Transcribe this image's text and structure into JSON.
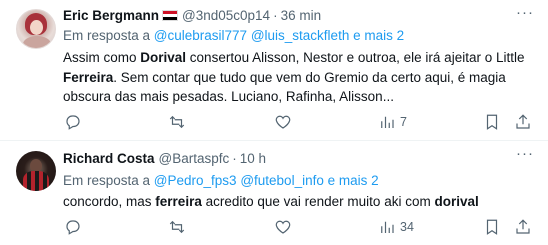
{
  "tweets": [
    {
      "author": "Eric Bergmann",
      "handle": "@3nd05c0p14",
      "separator": "·",
      "time": "36 min",
      "reply_prefix": "Em resposta a ",
      "reply_to": [
        "@culebrasil777",
        "@luis_stackfleth",
        "e mais 2"
      ],
      "text_parts": [
        {
          "t": "Assim como ",
          "b": false
        },
        {
          "t": "Dorival",
          "b": true
        },
        {
          "t": " consertou Alisson, Nestor e outroa, ele irá ajeitar o Little ",
          "b": false
        },
        {
          "t": "Ferreira",
          "b": true
        },
        {
          "t": ". Sem contar que tudo que vem do Gremio da certo aqui, é magia obscura das mais pesadas. Luciano, Rafinha, Alisson...",
          "b": false
        }
      ],
      "views": "7",
      "more_icon": "more-dots-icon"
    },
    {
      "author": "Richard Costa",
      "handle": "@Bartaspfc",
      "separator": "·",
      "time": "10 h",
      "reply_prefix": "Em resposta a ",
      "reply_to": [
        "@Pedro_fps3",
        "@futebol_info",
        "e mais 2"
      ],
      "text_parts": [
        {
          "t": "concordo, mas ",
          "b": false
        },
        {
          "t": "ferreira",
          "b": true
        },
        {
          "t": " acredito que vai render muito aki com ",
          "b": false
        },
        {
          "t": "dorival",
          "b": true
        }
      ],
      "views": "34",
      "more_icon": "more-dots-icon"
    }
  ],
  "colors": {
    "link": "#1d9bf0",
    "muted": "#536471",
    "text": "#0f1419"
  }
}
